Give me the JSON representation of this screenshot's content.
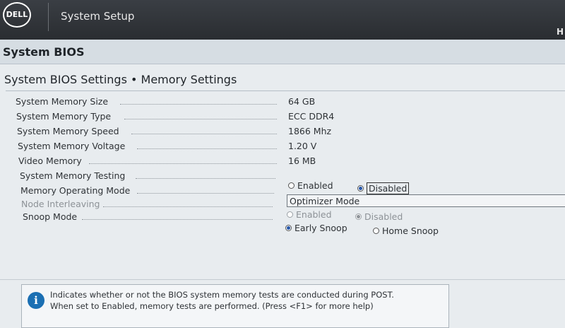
{
  "header": {
    "logo_text": "DELL",
    "app_title": "System Setup",
    "corner_text": "H"
  },
  "section": {
    "title": "System BIOS",
    "breadcrumb": "System BIOS Settings • Memory Settings"
  },
  "settings": [
    {
      "label": "System Memory Size",
      "value": "64 GB"
    },
    {
      "label": "System Memory Type",
      "value": "ECC DDR4"
    },
    {
      "label": "System Memory Speed",
      "value": "1866 Mhz"
    },
    {
      "label": "System Memory Voltage",
      "value": "1.20 V"
    },
    {
      "label": "Video Memory",
      "value": "16 MB"
    },
    {
      "label": "System Memory Testing",
      "options": [
        "Enabled",
        "Disabled"
      ],
      "selected": "Disabled"
    },
    {
      "label": "Memory Operating Mode",
      "value": "Optimizer Mode"
    },
    {
      "label": "Node Interleaving",
      "options": [
        "Enabled",
        "Disabled"
      ],
      "selected": "Disabled",
      "disabled": true
    },
    {
      "label": "Snoop Mode",
      "options": [
        "Early Snoop",
        "Home Snoop"
      ],
      "selected": "Early Snoop"
    }
  ],
  "help": {
    "line1": "Indicates whether or not the BIOS system memory tests are conducted during POST.",
    "line2": "When set to Enabled, memory tests are performed. (Press <F1> for more help)"
  }
}
